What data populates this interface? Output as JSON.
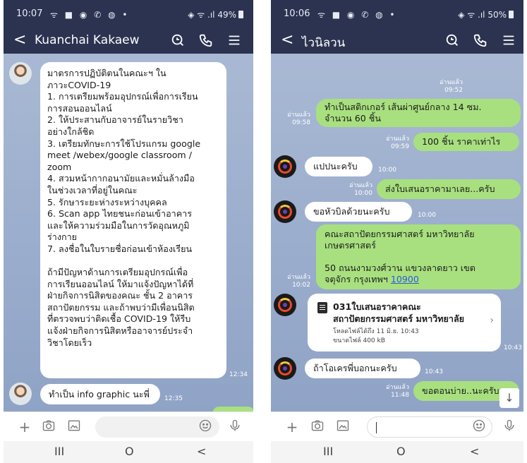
{
  "left": {
    "status": {
      "time": "10:07",
      "icons": "ᯤ ■ ◉ ✆ ◍ •",
      "signal": "◈ ᯤ .ıl",
      "battery": "49%"
    },
    "header": {
      "back": "<",
      "title": "Kuanchai Kakaew"
    },
    "messages": {
      "m1": "มาตรการปฏิบัติตนในคณะฯ ใน\nภาวะCOVID-19\n1. การเตรียมพร้อมอุปกรณ์เพื่อการเรียน\nการสอนออนไลน์\n2. ให้ประสานกับอาจารย์ในรายวิชา\nอย่างใกล้ชิด\n3. เตรียมทักษะการใช้โปรแกรม google\nmeet /webex/google classroom /\nzoom\n4. สวมหน้ากากอนามัยและหมั่นล้างมือ\nในช่วงเวลาที่อยู่ในคณะ\n5. รักษาระยะห่างระหว่างบุคคล\n6. Scan app ไทยชนะก่อนเข้าอาคาร\nและให้ความร่วมมือในการวัดอุณหภูมิ\nร่างกาย\n7. ลงชื่อในใบรายชื่อก่อนเข้าห้องเรียน\n\nถ้ามีปัญหาด้านการเตรียมอุปกรณ์เพื่อ\nการเรียนออนไลน์ ให้มาแจ้งปัญหาได้ที่\nฝ่ายกิจการนิสิตของคณะ ชั้น 2 อาคาร\nสถาปัตยกรรม และถ้าพบว่ามีเพื่อนนิสิต\nที่ตรวจพบว่าติดเชื้อ COVID-19 ให้รีบ\nแจ้งฝ่ายกิจการนิสิตหรืออาจารย์ประจำ\nวิชาโดยเร็ว",
      "m1_time": "12:34",
      "m2": "ทำเป็น info graphic นะพี่",
      "m2_time": "12:35"
    }
  },
  "right": {
    "status": {
      "time": "10:06",
      "icons": "ᯤ ■ ◉ ✆ ◍ •",
      "signal": "◈ ᯤ .ıl",
      "battery": "50%"
    },
    "header": {
      "back": "<",
      "title": "ไวนิลวน"
    },
    "read": "อ่านแล้ว",
    "messages": {
      "r0_time": "09:52",
      "r1": "ทำเป็นสติกเกอร์ เส้นผ่าศูนย์กลาง 14 ซม.\nจำนวน 60 ชิ้น",
      "r1_time": "09:58",
      "r2": "100 ชิ้น ราคาเท่าไร",
      "r2_time": "09:59",
      "r3": "แปปนะครับ",
      "r3_time": "10:00",
      "r4": "ส่งใบเสนอราคามาเลย...ครับ",
      "r4_time": "10:00",
      "r5": "ขอหัวบิลด้วยนะครับ",
      "r5_time": "10:00",
      "r6_a": "คณะสถาปัตยกรรมศาสตร์ มหาวิทยาลัย\nเกษตรศาสตร์\n\n50 ถนนงามวงศ์วาน แขวงลาดยาว เขต\nจตุจักร กรุงเทพฯ ",
      "r6_link": "10900",
      "r6_time": "10:02",
      "file_name": "031ใบเสนอราคาคณะ\nสถาปัตยกรรมศาสตร์ มหาวิทยาลัย",
      "file_meta": "โหลดไฟล์ได้ถึง 11 มิ.ย. 10:43\nขนาดไฟล์ 400 kB",
      "file_time": "10:43",
      "r7": "ถ้าโอเครพี่บอกนะครับ",
      "r7_time": "10:43",
      "r8": "ขอตอนบ่าย..นะครับ",
      "r8_time": "11:48"
    }
  },
  "nav": {
    "recent": "III",
    "home": "O",
    "back": "<"
  },
  "colors": {
    "header": "#2b3350",
    "chat_bg": "#9fb1cf",
    "bubble_out": "#a8e07f",
    "bubble_in": "#ffffff",
    "link": "#2a5bd7"
  }
}
